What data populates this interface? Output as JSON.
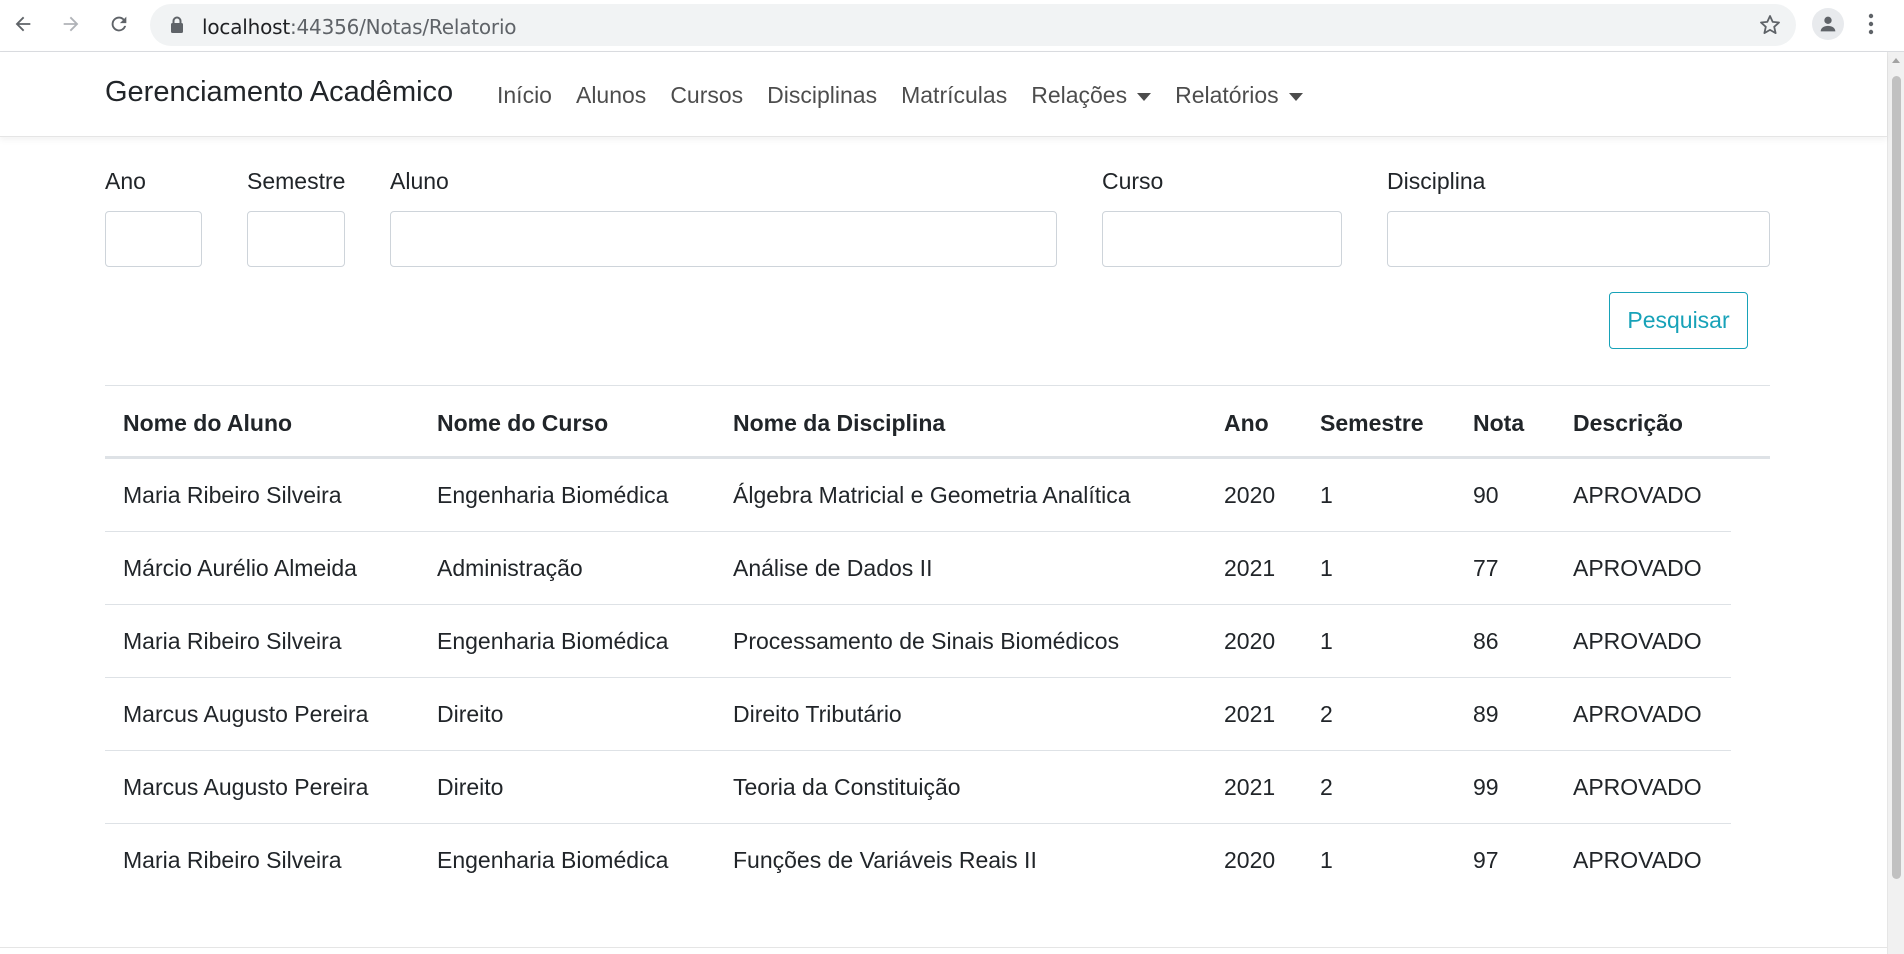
{
  "browser": {
    "url_host": "localhost",
    "url_rest": ":44356/Notas/Relatorio"
  },
  "navbar": {
    "brand": "Gerenciamento Acadêmico",
    "links": [
      {
        "label": "Início"
      },
      {
        "label": "Alunos"
      },
      {
        "label": "Cursos"
      },
      {
        "label": "Disciplinas"
      },
      {
        "label": "Matrículas"
      },
      {
        "label": "Relações",
        "dropdown": true
      },
      {
        "label": "Relatórios",
        "dropdown": true
      }
    ]
  },
  "filters": {
    "ano": {
      "label": "Ano",
      "value": ""
    },
    "semestre": {
      "label": "Semestre",
      "value": ""
    },
    "aluno": {
      "label": "Aluno",
      "value": ""
    },
    "curso": {
      "label": "Curso",
      "value": ""
    },
    "disciplina": {
      "label": "Disciplina",
      "value": ""
    },
    "search_button": "Pesquisar"
  },
  "table": {
    "headers": [
      "Nome do Aluno",
      "Nome do Curso",
      "Nome da Disciplina",
      "Ano",
      "Semestre",
      "Nota",
      "Descrição"
    ],
    "rows": [
      [
        "Maria Ribeiro Silveira",
        "Engenharia Biomédica",
        "Álgebra Matricial e Geometria Analítica",
        "2020",
        "1",
        "90",
        "APROVADO"
      ],
      [
        "Márcio Aurélio Almeida",
        "Administração",
        "Análise de Dados II",
        "2021",
        "1",
        "77",
        "APROVADO"
      ],
      [
        "Maria Ribeiro Silveira",
        "Engenharia Biomédica",
        "Processamento de Sinais Biomédicos",
        "2020",
        "1",
        "86",
        "APROVADO"
      ],
      [
        "Marcus Augusto Pereira",
        "Direito",
        "Direito Tributário",
        "2021",
        "2",
        "89",
        "APROVADO"
      ],
      [
        "Marcus Augusto Pereira",
        "Direito",
        "Teoria da Constituição",
        "2021",
        "2",
        "99",
        "APROVADO"
      ],
      [
        "Maria Ribeiro Silveira",
        "Engenharia Biomédica",
        "Funções de Variáveis Reais II",
        "2020",
        "1",
        "97",
        "APROVADO"
      ]
    ]
  },
  "colors": {
    "accent": "#17a2b8",
    "border": "#dee2e6"
  }
}
